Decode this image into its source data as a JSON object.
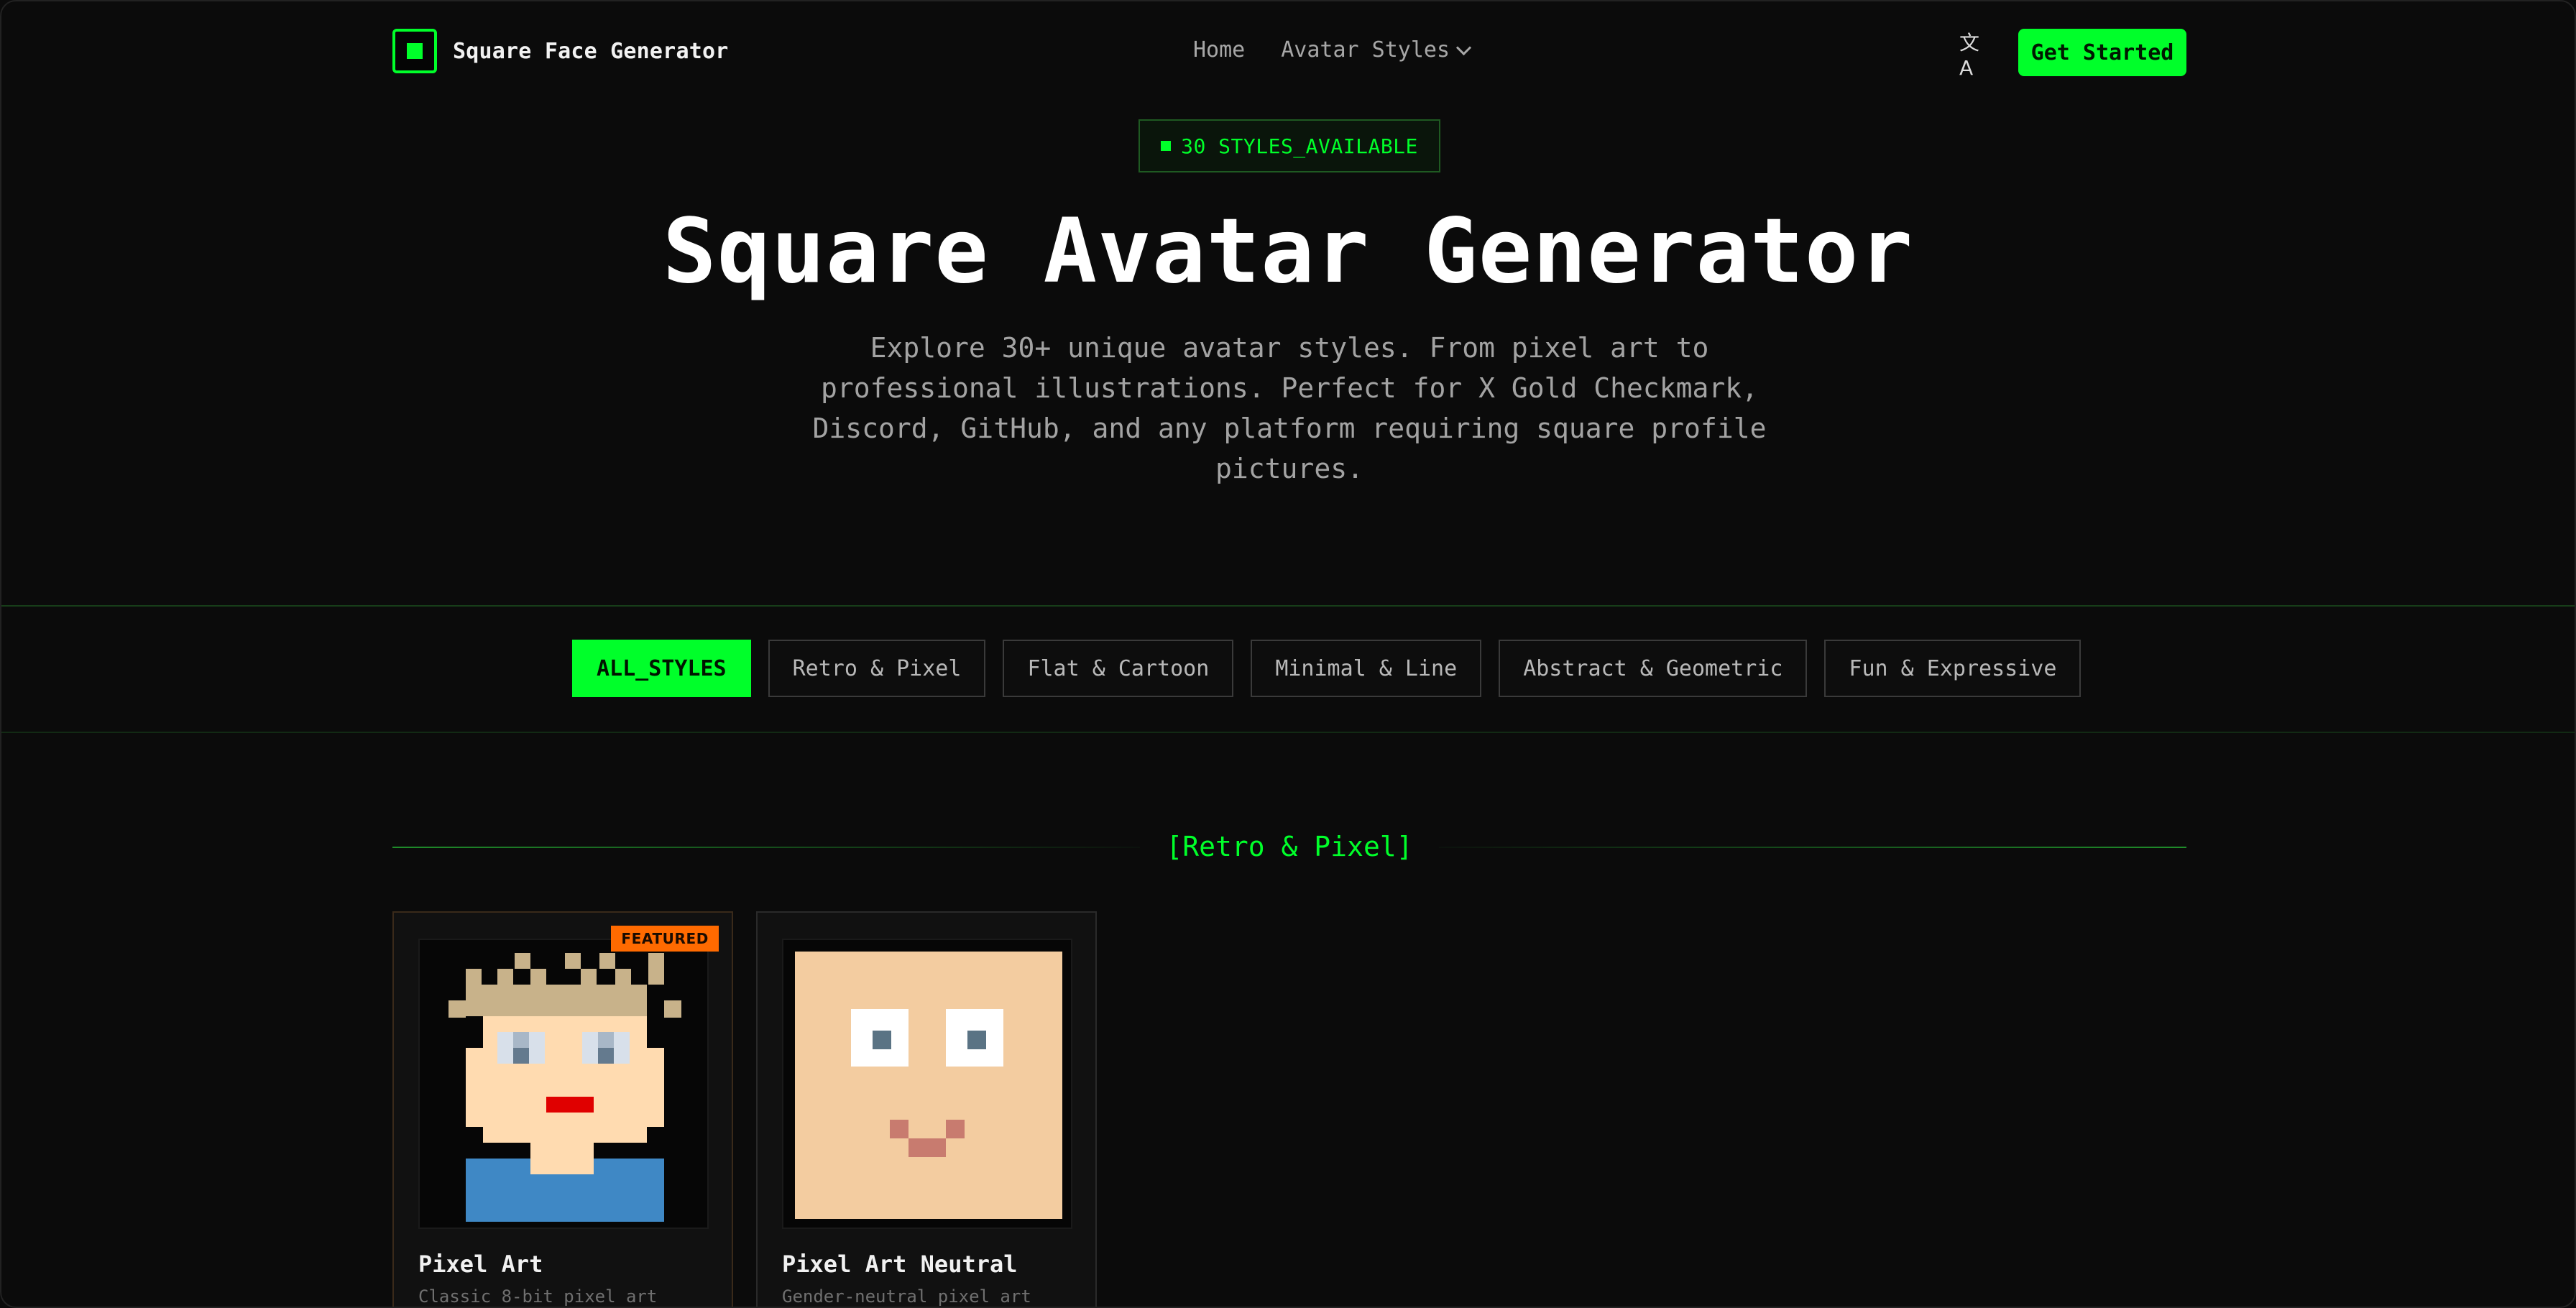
{
  "brand": {
    "name": "Square Face Generator"
  },
  "nav": {
    "home": "Home",
    "avatar_styles": "Avatar Styles"
  },
  "header_actions": {
    "language_icon": "translate-icon",
    "get_started": "Get Started"
  },
  "hero": {
    "badge": "30 STYLES_AVAILABLE",
    "title": "Square Avatar Generator",
    "description": "Explore 30+ unique avatar styles. From pixel art to professional illustrations. Perfect for X Gold Checkmark, Discord, GitHub, and any platform requiring square profile pictures."
  },
  "filters": [
    {
      "label": "ALL_STYLES",
      "active": true
    },
    {
      "label": "Retro & Pixel",
      "active": false
    },
    {
      "label": "Flat & Cartoon",
      "active": false
    },
    {
      "label": "Minimal & Line",
      "active": false
    },
    {
      "label": "Abstract & Geometric",
      "active": false
    },
    {
      "label": "Fun & Expressive",
      "active": false
    }
  ],
  "section": {
    "title": "[Retro & Pixel]"
  },
  "cards": [
    {
      "badge": "FEATURED",
      "title": "Pixel Art",
      "subtitle": "Classic 8-bit pixel art"
    },
    {
      "title": "Pixel Art Neutral",
      "subtitle": "Gender-neutral pixel art"
    }
  ],
  "colors": {
    "accent": "#00ff2a",
    "featured": "#ff6a00"
  }
}
